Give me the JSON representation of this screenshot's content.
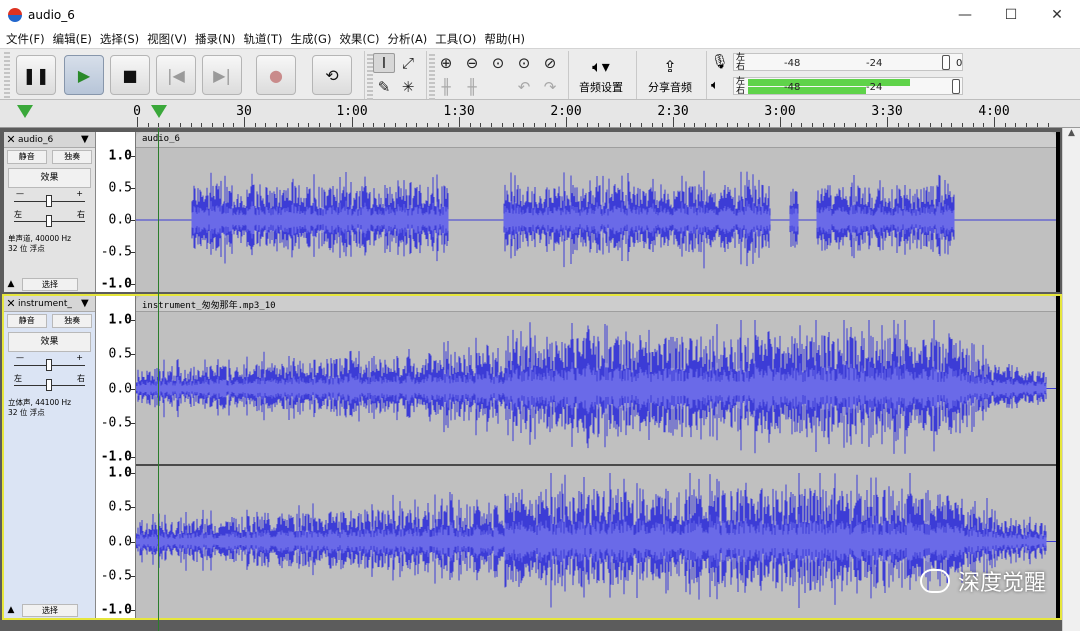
{
  "window": {
    "title": "audio_6"
  },
  "window_buttons": {
    "minimize": "—",
    "maximize": "☐",
    "close": "✕"
  },
  "menu": [
    "文件(F)",
    "编辑(E)",
    "选择(S)",
    "视图(V)",
    "播录(N)",
    "轨道(T)",
    "生成(G)",
    "效果(C)",
    "分析(A)",
    "工具(O)",
    "帮助(H)"
  ],
  "toolbar": {
    "transport": {
      "pause": "❚❚",
      "play": "▶",
      "stop": "■",
      "skip_start": "|◀",
      "skip_end": "▶|",
      "record": "●",
      "loop": "⟲"
    },
    "audio_setup_label": "音频设置",
    "share_audio_label": "分享音频",
    "meter": {
      "left": "左",
      "right": "右",
      "tick_a": "-48",
      "tick_b": "-24",
      "tick_c": "0"
    }
  },
  "timeline": {
    "ticks": [
      {
        "label": "0",
        "pos": 137
      },
      {
        "label": "30",
        "pos": 244
      },
      {
        "label": "1:00",
        "pos": 352
      },
      {
        "label": "1:30",
        "pos": 459
      },
      {
        "label": "2:00",
        "pos": 566
      },
      {
        "label": "2:30",
        "pos": 673
      },
      {
        "label": "3:00",
        "pos": 780
      },
      {
        "label": "3:30",
        "pos": 887
      },
      {
        "label": "4:00",
        "pos": 994
      }
    ]
  },
  "tracks": [
    {
      "name": "audio_6",
      "clip_name": "audio_6",
      "mute": "静音",
      "solo": "独奏",
      "effects": "效果",
      "gain_minus": "—",
      "gain_plus": "+",
      "pan_left": "左",
      "pan_right": "右",
      "info_line1": "单声道, 40000 Hz",
      "info_line2": "32 位 浮点",
      "select": "选择",
      "scale": [
        "1.0",
        "0.5",
        "0.0",
        "-0.5",
        "-1.0"
      ],
      "channels": 1,
      "regions": [
        [
          0.06,
          0.34
        ],
        [
          0.4,
          0.69
        ],
        [
          0.71,
          0.72
        ],
        [
          0.74,
          0.89
        ]
      ]
    },
    {
      "name": "instrument_",
      "clip_name": "instrument_匆匆那年.mp3_10",
      "mute": "静音",
      "solo": "独奏",
      "effects": "效果",
      "gain_minus": "—",
      "gain_plus": "+",
      "pan_left": "左",
      "pan_right": "右",
      "info_line1": "立体声, 44100 Hz",
      "info_line2": "32 位 浮点",
      "select": "选择",
      "scale": [
        "1.0",
        "0.5",
        "0.0",
        "-0.5",
        "-1.0"
      ],
      "channels": 2,
      "regions": [
        [
          0.0,
          0.99
        ]
      ]
    }
  ],
  "watermark": "深度觉醒",
  "colors": {
    "wave": "#3c3cd6",
    "wave_bg": "#c0c0c0",
    "playhead": "#2b7d2b",
    "selected_track": "#e6e63c",
    "meter_green": "#5fd34a"
  }
}
